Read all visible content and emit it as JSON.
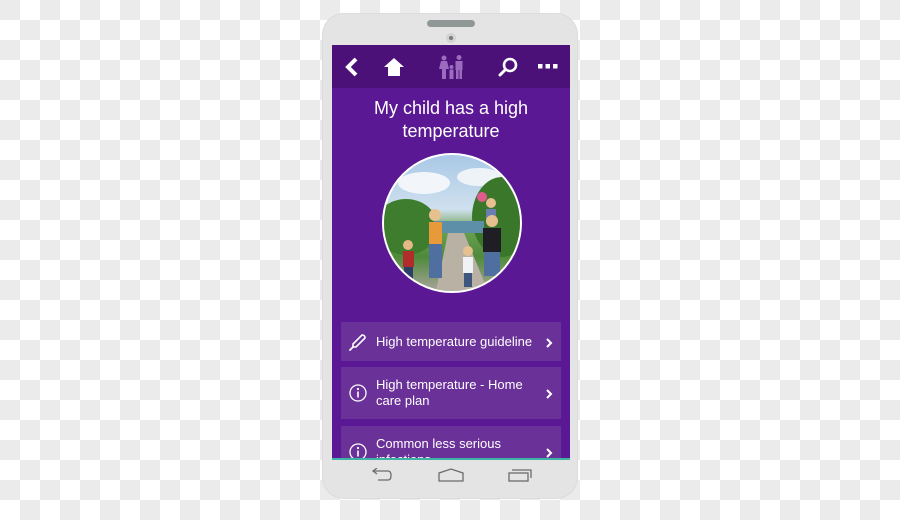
{
  "topbar": {
    "icons": [
      {
        "name": "back-icon",
        "label": "Back"
      },
      {
        "name": "home-icon",
        "label": "Home"
      },
      {
        "name": "family-icon",
        "label": "Family"
      },
      {
        "name": "search-icon",
        "label": "Search"
      },
      {
        "name": "more-icon",
        "label": "More"
      }
    ]
  },
  "page": {
    "title": "My child has a high temperature",
    "photo_alt": "Family walking on a country road"
  },
  "menu": {
    "items": [
      {
        "icon": "thermometer-icon",
        "label": "High temperature guideline"
      },
      {
        "icon": "info-icon",
        "label": "High temperature - Home care plan"
      },
      {
        "icon": "info-icon",
        "label": "Common less serious infections"
      }
    ]
  },
  "navbar": {
    "back": "Back",
    "home": "Home",
    "recents": "Recent apps"
  },
  "colors": {
    "topbar": "#4b1178",
    "screen": "#5b1894",
    "card": "#6a3198",
    "accent_line": "#3fb3a6",
    "phone_body": "#e4e4e4"
  }
}
